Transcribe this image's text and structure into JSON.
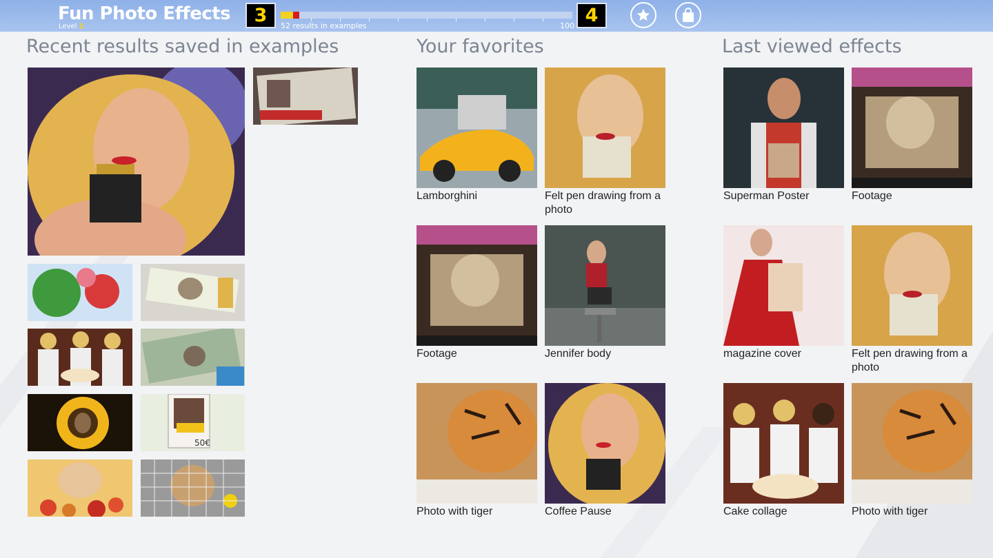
{
  "header": {
    "app_title": "Fun Photo Effects",
    "level_label": "Level",
    "level_number": "2",
    "current_level": "3",
    "next_level": "4",
    "progress_text": "52 results in examples",
    "progress_max": "100",
    "progress_value": 0.52,
    "favorites_icon": "star-icon",
    "store_icon": "shopping-bag-icon"
  },
  "recent": {
    "title": "Recent results saved in examples",
    "items": [
      {
        "image": "blonde woman with coffee cup"
      },
      {
        "image": "newspaper front page"
      },
      {
        "image": "bubble with balloons"
      },
      {
        "image": "banknote stack portrait"
      },
      {
        "image": "hooters girls with cake"
      },
      {
        "image": "dollar bills portrait"
      },
      {
        "image": "sunflower portrait"
      },
      {
        "image": "postage stamp 50€"
      },
      {
        "image": "fruit bowl portrait"
      },
      {
        "image": "tiled mosaic portrait"
      }
    ]
  },
  "favorites": {
    "title": "Your favorites",
    "items": [
      {
        "label": "Lamborghini"
      },
      {
        "label": "Felt pen drawing from a photo"
      },
      {
        "label": "Footage"
      },
      {
        "label": "Jennifer body"
      },
      {
        "label": "Photo with tiger"
      },
      {
        "label": "Coffee Pause"
      }
    ]
  },
  "last_viewed": {
    "title": "Last viewed effects",
    "items": [
      {
        "label": "Superman Poster"
      },
      {
        "label": "Footage"
      },
      {
        "label": "magazine cover"
      },
      {
        "label": "Felt pen drawing from a photo"
      },
      {
        "label": "Cake collage"
      },
      {
        "label": "Photo with tiger"
      }
    ]
  },
  "colors": {
    "header_bg": "#a3c0ee",
    "level_digit": "#ffd400",
    "progress_red": "#d51c1c",
    "title_gray": "#7b8592"
  }
}
